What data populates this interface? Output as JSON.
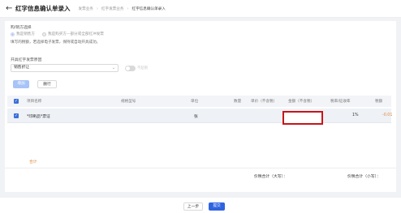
{
  "header": {
    "back_icon": "arrow-left-icon",
    "title": "红字信息确认单录入",
    "breadcrumb": [
      "发票业务",
      "红字发票业务",
      "红字信息确认单录入"
    ]
  },
  "form": {
    "identity_label": "购/销方选择",
    "radios": [
      "我是销售方",
      "我是购买方—部分或全部红冲发票"
    ],
    "tip": "填写的税额，若选择电子发票，保持或自动开具成功。",
    "invoice_type_label": "开具红字发票原因",
    "invoice_type_value": "销售折让",
    "toggle_text": "不超限"
  },
  "toolbar": {
    "add_label": "增加",
    "delete_label": "删行"
  },
  "table": {
    "headers": [
      "项目名称",
      "规格型号",
      "单位",
      "数量",
      "单价（不含税）",
      "金额（不含税）",
      "税率/征收率",
      "税额"
    ],
    "rows": [
      {
        "name": "*印刷品*票证",
        "spec": "",
        "unit": "张",
        "qty": "",
        "price": "",
        "amount": "",
        "rate": "1%",
        "tax": "-0.01"
      }
    ]
  },
  "totals": {
    "label": "合计",
    "price_tax_big": "价税合计（大写）：",
    "price_tax_small": "价税合计（小写）："
  },
  "footer": {
    "prev_label": "上一步",
    "submit_label": "提交"
  },
  "colors": {
    "primary": "#2f64e0",
    "highlight": "#c9141b",
    "negative": "#e0873b"
  }
}
